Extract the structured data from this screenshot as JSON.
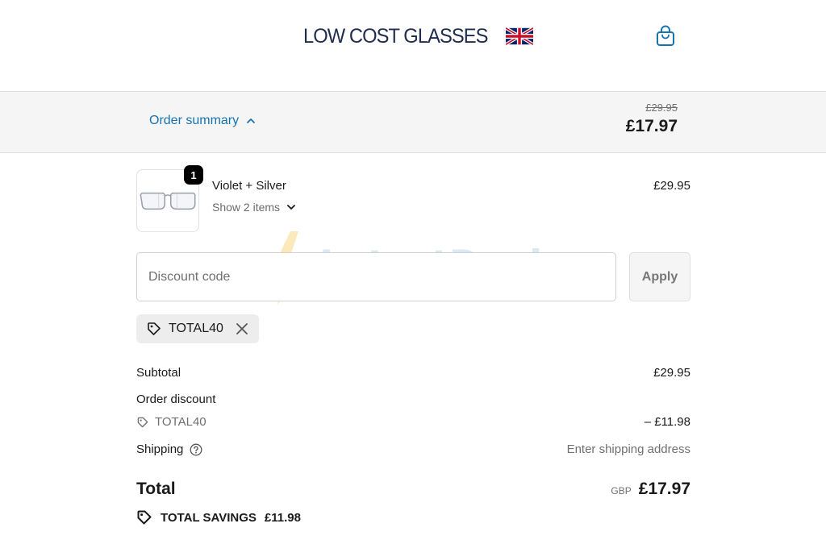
{
  "header": {
    "logo_text": "LOW COST GLASSES",
    "logo_flag": "uk-flag-icon",
    "cart_icon": "shopping-bag-icon"
  },
  "summary_bar": {
    "toggle_label": "Order summary",
    "toggle_icon": "chevron-up-icon",
    "original_price": "£29.95",
    "current_price": "£17.97"
  },
  "product": {
    "quantity": "1",
    "name": "Violet + Silver",
    "show_items_label": "Show 2 items",
    "price": "£29.95",
    "image_icon": "eyeglasses-icon"
  },
  "discount": {
    "placeholder": "Discount code",
    "apply_label": "Apply",
    "applied_code": "TOTAL40"
  },
  "totals": {
    "subtotal_label": "Subtotal",
    "subtotal_value": "£29.95",
    "order_discount_label": "Order discount",
    "discount_code": "TOTAL40",
    "discount_value": "– £11.98",
    "shipping_label": "Shipping",
    "shipping_value": "Enter shipping address",
    "total_label": "Total",
    "currency": "GBP",
    "total_value": "£17.97",
    "savings_label": "TOTAL SAVINGS",
    "savings_value": "£11.98"
  },
  "watermark": {
    "brand": "LatestDeals",
    "domain": ".co.uk"
  },
  "colors": {
    "link_blue": "#1773b0",
    "logo_navy": "#1e2d4f",
    "summary_bg": "#f5f5f5",
    "muted_text": "#707070"
  }
}
